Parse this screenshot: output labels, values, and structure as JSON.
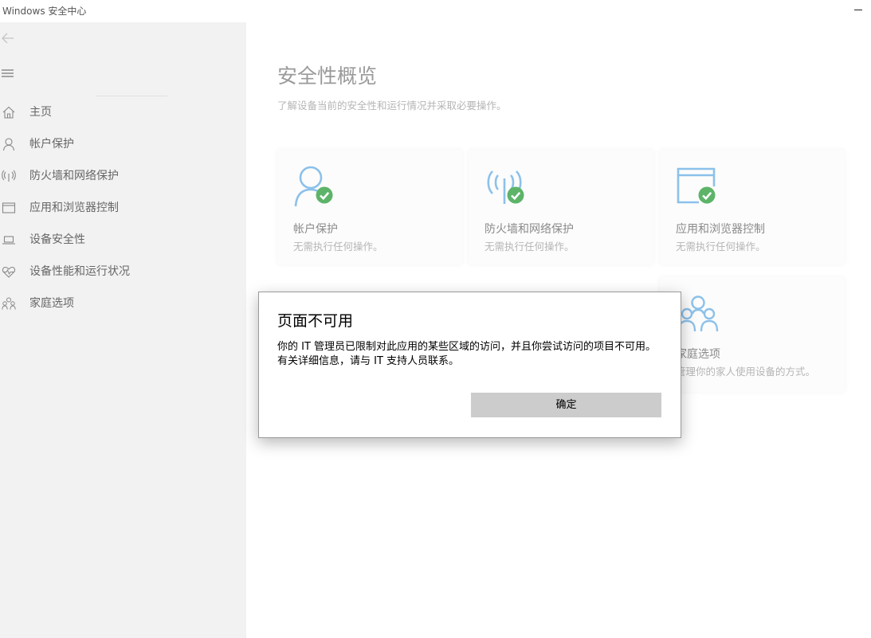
{
  "window": {
    "title": "Windows 安全中心"
  },
  "sidebar": {
    "items": [
      {
        "label": "主页",
        "icon": "home-icon"
      },
      {
        "label": "帐户保护",
        "icon": "person-icon"
      },
      {
        "label": "防火墙和网络保护",
        "icon": "wireless-icon"
      },
      {
        "label": "应用和浏览器控制",
        "icon": "app-window-icon"
      },
      {
        "label": "设备安全性",
        "icon": "laptop-icon"
      },
      {
        "label": "设备性能和运行状况",
        "icon": "heart-icon"
      },
      {
        "label": "家庭选项",
        "icon": "family-icon"
      }
    ]
  },
  "main": {
    "title": "安全性概览",
    "subtitle": "了解设备当前的安全性和运行情况并采取必要操作。",
    "tiles": [
      {
        "title": "帐户保护",
        "status": "无需执行任何操作。",
        "icon": "person-check-icon"
      },
      {
        "title": "防火墙和网络保护",
        "status": "无需执行任何操作。",
        "icon": "wireless-check-icon"
      },
      {
        "title": "应用和浏览器控制",
        "status": "无需执行任何操作。",
        "icon": "app-window-check-icon"
      },
      {
        "title": "家庭选项",
        "status": "管理你的家人使用设备的方式。",
        "icon": "family-icon"
      }
    ]
  },
  "dialog": {
    "title": "页面不可用",
    "message": "你的 IT 管理员已限制对此应用的某些区域的访问，并且你尝试访问的项目不可用。有关详细信息，请与 IT 支持人员联系。",
    "ok_label": "确定"
  },
  "colors": {
    "accent": "#8cc1ea",
    "ok_green": "#5db469",
    "sidebar_bg": "#f2f2f2",
    "button_bg": "#cccccc"
  }
}
